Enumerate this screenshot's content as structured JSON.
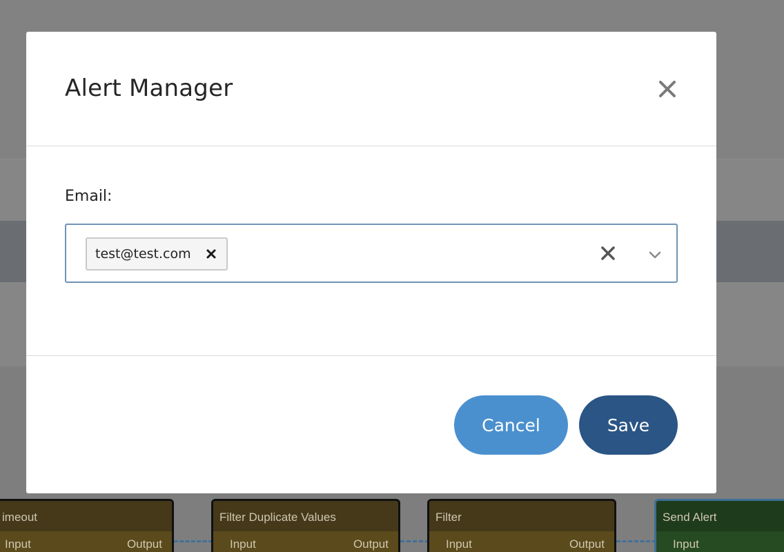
{
  "modal": {
    "title": "Alert Manager",
    "close_icon": "close-icon"
  },
  "email_field": {
    "label": "Email:",
    "selected_values": [
      "test@test.com"
    ],
    "clear_icon": "clear-icon",
    "dropdown_icon": "chevron-down-icon"
  },
  "footer": {
    "cancel_label": "Cancel",
    "save_label": "Save"
  },
  "workflow": {
    "nodes": [
      {
        "title": "imeout",
        "input": "Input",
        "output": "Output"
      },
      {
        "title": "Filter Duplicate Values",
        "input": "Input",
        "output": "Output"
      },
      {
        "title": "Filter",
        "input": "Input",
        "output": "Output"
      },
      {
        "title": "Send Alert",
        "input": "Input"
      }
    ]
  },
  "colors": {
    "cancel_button": "#4a90cf",
    "save_button": "#2a5585",
    "select_border": "#6f93b6",
    "node_amber": "#45391a",
    "node_green": "#1e3b1b"
  }
}
